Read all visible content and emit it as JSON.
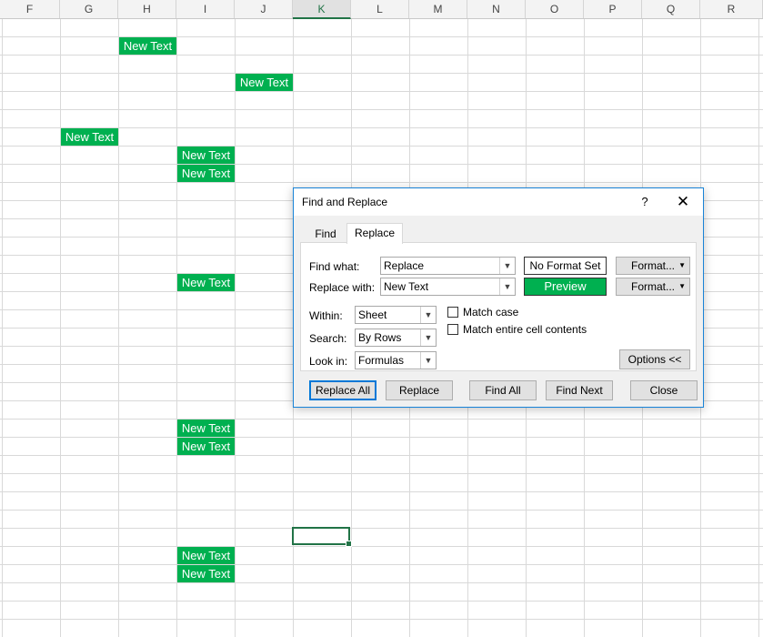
{
  "sheet": {
    "columns": [
      "F",
      "G",
      "H",
      "I",
      "J",
      "K",
      "L",
      "M",
      "N",
      "O",
      "P",
      "Q",
      "R"
    ],
    "active_column": "K",
    "cell_text": "New Text",
    "fill_color": "#00b050"
  },
  "dialog": {
    "title": "Find and Replace",
    "help": "?",
    "close_glyph": "✕",
    "tabs": {
      "find": "Find",
      "replace": "Replace"
    },
    "find_what": {
      "label": "Find what:",
      "value": "Replace",
      "preview": "No Format Set"
    },
    "replace_with": {
      "label": "Replace with:",
      "value": "New Text",
      "preview": "Preview"
    },
    "format_label": "Format...",
    "within": {
      "label": "Within:",
      "value": "Sheet"
    },
    "search": {
      "label": "Search:",
      "value": "By Rows"
    },
    "look_in": {
      "label": "Look in:",
      "value": "Formulas"
    },
    "match_case": {
      "label": "Match case",
      "checked": false
    },
    "match_entire": {
      "label": "Match entire cell contents",
      "checked": false
    },
    "options_label": "Options <<",
    "buttons": {
      "replace_all": "Replace All",
      "replace": "Replace",
      "find_all": "Find All",
      "find_next": "Find Next",
      "close": "Close"
    }
  },
  "colors": {
    "accent": "#1883d7",
    "excel_green": "#217346",
    "preview_green": "#00b050"
  }
}
